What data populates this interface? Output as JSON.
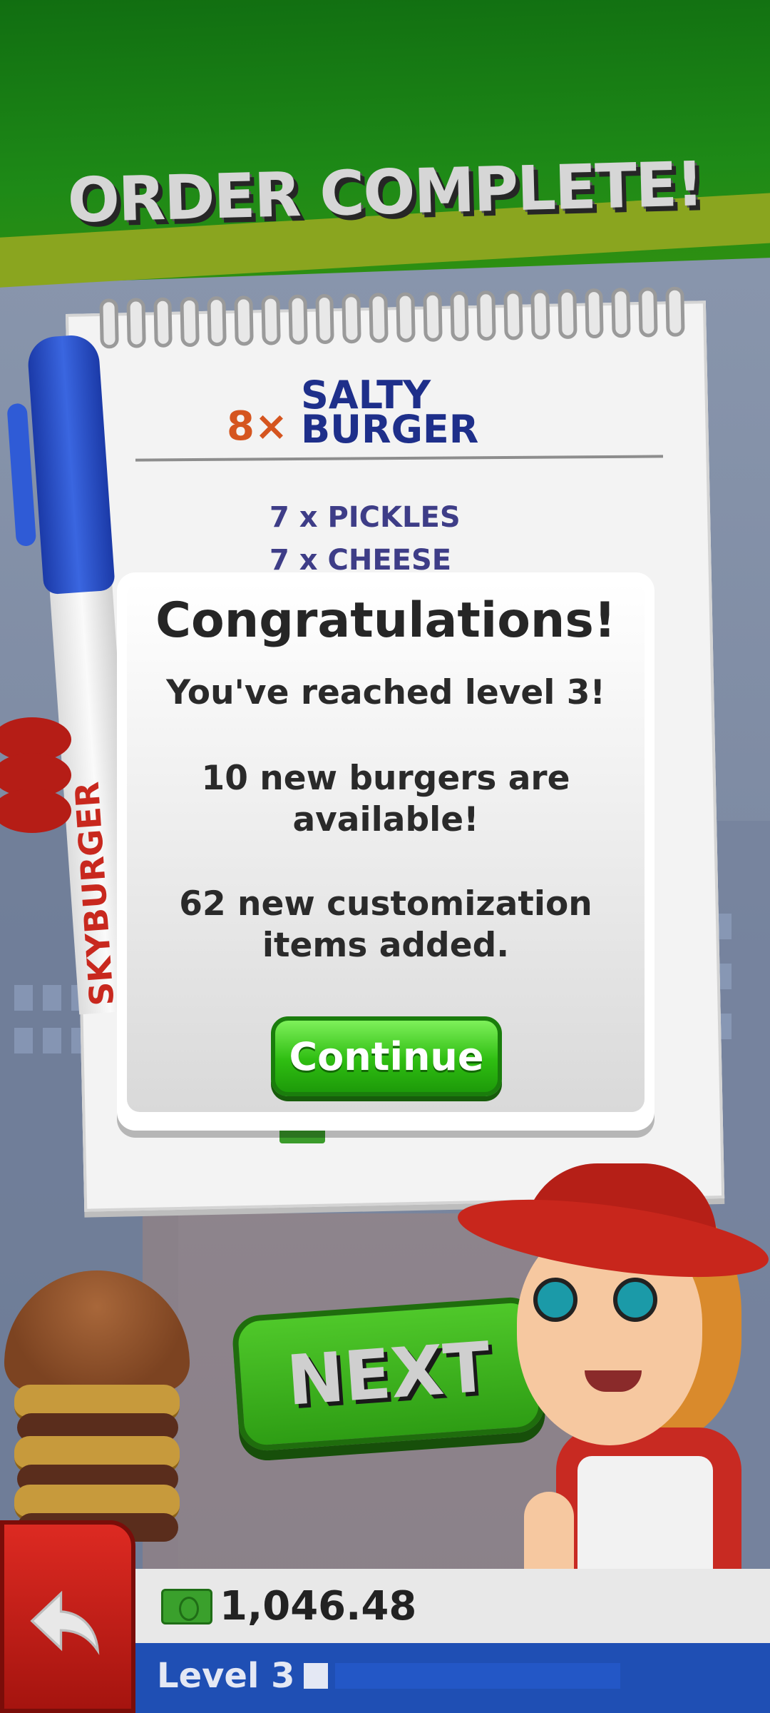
{
  "banner": {
    "title": "ORDER COMPLETE!"
  },
  "order": {
    "quantity": "8×",
    "burger_name_line1": "SALTY",
    "burger_name_line2": "BURGER",
    "ingredients": [
      "7 x PICKLES",
      "7 x CHEESE"
    ],
    "pen_brand": "SKYBURGER"
  },
  "modal": {
    "title": "Congratulations!",
    "level_message": "You've reached level 3!",
    "burgers_message": "10 new burgers are available!",
    "items_message": "62 new customization items added.",
    "continue_label": "Continue"
  },
  "next_button": {
    "label": "NEXT"
  },
  "hud": {
    "cash": "1,046.48",
    "level_label": "Level 3"
  },
  "icons": {
    "back": "back-arrow-icon",
    "cash": "cash-icon"
  },
  "colors": {
    "banner_green": "#1e8a17",
    "continue_green": "#2fbe12",
    "back_red": "#c81e18",
    "hud_blue": "#1f4fb4"
  }
}
